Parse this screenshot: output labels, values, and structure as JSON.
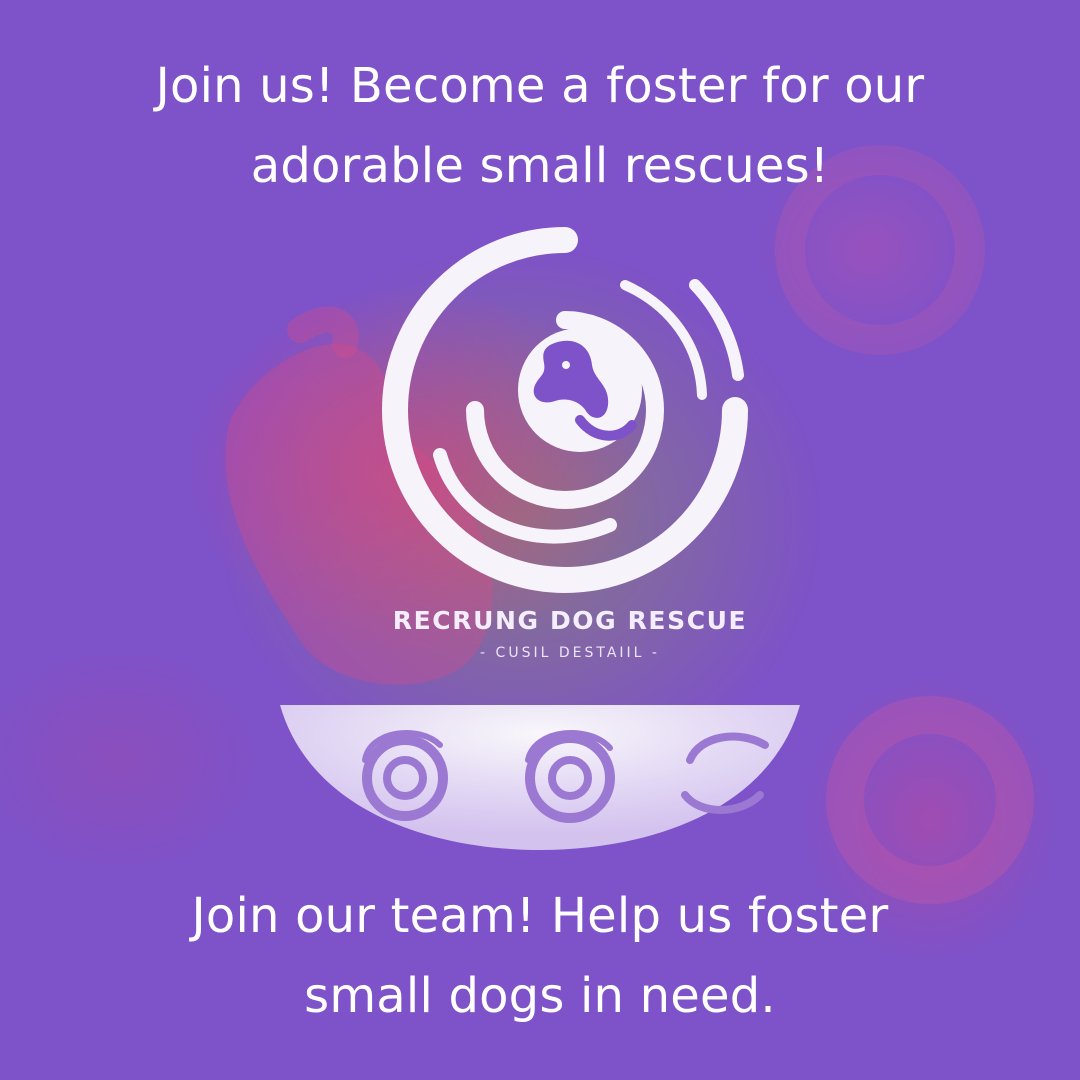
{
  "headline_top": {
    "line1": "Join us! Become a foster for our",
    "line2": "adorable small rescues!"
  },
  "logo": {
    "name": "RECRUNG DOG RESCUE",
    "tagline": "- CUSIL DESTAIIL -"
  },
  "headline_bottom": {
    "line1": "Join our team! Help us foster",
    "line2": "small dogs in need."
  },
  "colors": {
    "background": "#7e52c8",
    "text": "#ffffff",
    "accent_pink": "#e63c78",
    "accent_green": "#8c9650"
  }
}
